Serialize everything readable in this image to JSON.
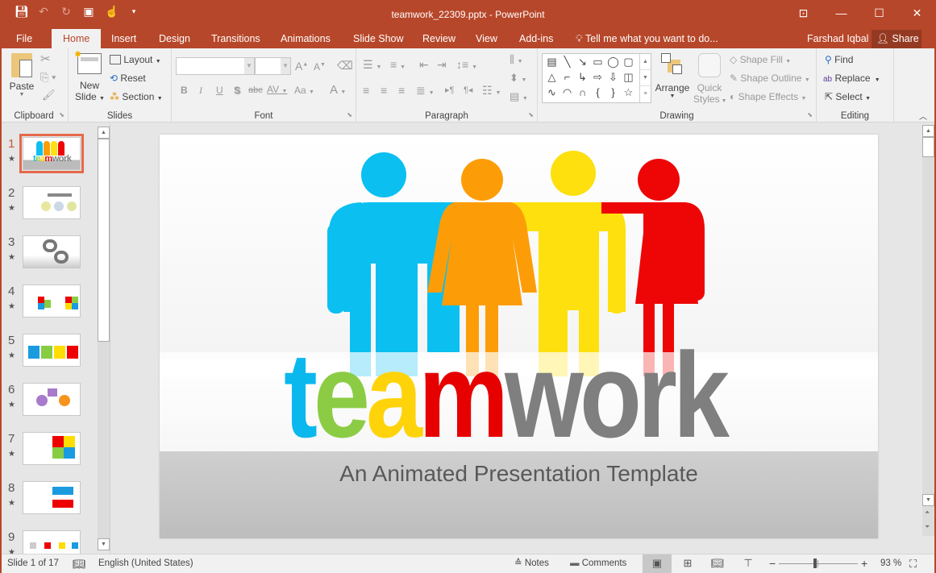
{
  "window": {
    "title": "teamwork_22309.pptx - PowerPoint",
    "accent": "#b7472a",
    "controls": [
      "ribbon-display-options",
      "minimize",
      "maximize",
      "close"
    ]
  },
  "quick_access": [
    "save",
    "undo",
    "redo",
    "start-from-beginning",
    "touch-mode",
    "customize"
  ],
  "tabs": [
    {
      "label": "File"
    },
    {
      "label": "Home",
      "active": true
    },
    {
      "label": "Insert"
    },
    {
      "label": "Design"
    },
    {
      "label": "Transitions"
    },
    {
      "label": "Animations"
    },
    {
      "label": "Slide Show"
    },
    {
      "label": "Review"
    },
    {
      "label": "View"
    },
    {
      "label": "Add-ins"
    }
  ],
  "tell_me": "Tell me what you want to do...",
  "user_name": "Farshad Iqbal",
  "share_label": "Share",
  "ribbon": {
    "clipboard": {
      "label": "Clipboard",
      "paste": "Paste"
    },
    "slides": {
      "label": "Slides",
      "new_slide_1": "New",
      "new_slide_2": "Slide",
      "layout": "Layout",
      "reset": "Reset",
      "section": "Section"
    },
    "font": {
      "label": "Font",
      "font_name": "",
      "font_size": "",
      "bold": "B",
      "italic": "I",
      "underline": "U",
      "shadow": "S",
      "strike": "abc",
      "spacing": "AV",
      "case": "Aa",
      "color": "A",
      "grow": "A",
      "shrink": "A"
    },
    "paragraph": {
      "label": "Paragraph"
    },
    "drawing": {
      "label": "Drawing",
      "arrange": "Arrange",
      "quick_1": "Quick",
      "quick_2": "Styles",
      "shape_fill": "Shape Fill",
      "shape_outline": "Shape Outline",
      "shape_effects": "Shape Effects"
    },
    "editing": {
      "label": "Editing",
      "find": "Find",
      "replace": "Replace",
      "select": "Select"
    }
  },
  "slides_panel": {
    "selected": 1,
    "items": [
      {
        "num": "1"
      },
      {
        "num": "2"
      },
      {
        "num": "3"
      },
      {
        "num": "4"
      },
      {
        "num": "5"
      },
      {
        "num": "6"
      },
      {
        "num": "7"
      },
      {
        "num": "8"
      },
      {
        "num": "9"
      }
    ]
  },
  "slide": {
    "word_parts": [
      {
        "text": "t",
        "color": "#0ab8ee"
      },
      {
        "text": "e",
        "color": "#8ccc45"
      },
      {
        "text": "a",
        "color": "#fed30a"
      },
      {
        "text": "m",
        "color": "#e60000"
      },
      {
        "text": "work",
        "color": "#7f7f7f"
      }
    ],
    "subtitle": "An Animated Presentation Template",
    "figure_colors": [
      "#0bbff0",
      "#fc9d08",
      "#fde00e",
      "#ee0606"
    ]
  },
  "status": {
    "slide_info": "Slide 1 of 17",
    "language": "English (United States)",
    "notes": "Notes",
    "comments": "Comments",
    "zoom": "93 %",
    "zoom_level_percent": 93
  }
}
